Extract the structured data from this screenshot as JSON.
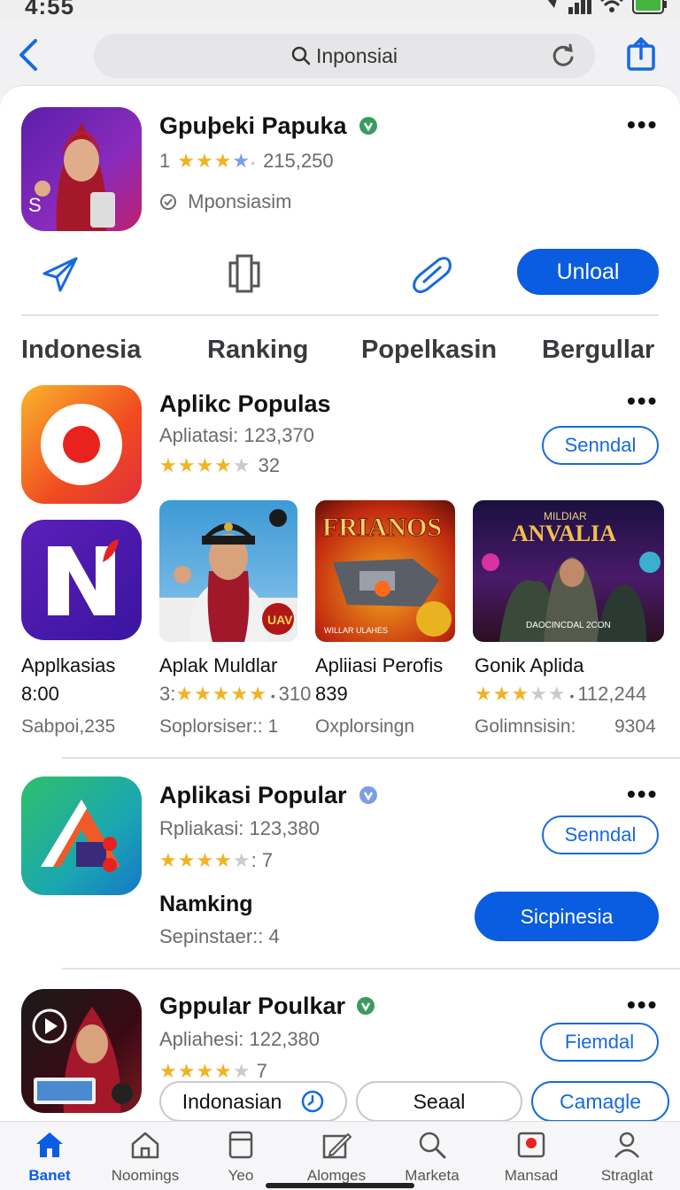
{
  "status": {
    "time": "4:55"
  },
  "topbar": {
    "search_text": "Inponsiai"
  },
  "hero": {
    "title": "Gpuþeki Papuka",
    "rating_prefix": "1",
    "rating_count": "215,250",
    "developer": "Mponsiasim",
    "download_label": "Unloal"
  },
  "tabs": [
    "Indonesia",
    "Ranking",
    "Popelkasin",
    "Bergullar"
  ],
  "section1": {
    "title": "Aplikc Populas",
    "subtitle": "Apliatasi: 123,370",
    "rating_count": "32",
    "button": "Senndal"
  },
  "cards": [
    {
      "name": "Applkasias",
      "value": "8:00",
      "sub": "Sabpoi",
      "sub2": "235"
    },
    {
      "name": "Aplak Muldlar",
      "value": "3:",
      "rating_count": "310",
      "sub": "Soplorsiser:: 1",
      "badge": "UAV"
    },
    {
      "name": "Apliiasi Perofis",
      "value": "839",
      "sub": "Oxplorsingn",
      "poster_text": "FRIANOS",
      "poster_caption": "WILLAR ULAHES"
    },
    {
      "name": "Gonik Aplida",
      "rating_count": "112,244",
      "sub": "Golimnsisin:",
      "sub2": "9304",
      "poster_top": "MILDIAR",
      "poster_text": "ANVALIA",
      "poster_caption": "DAOCINCDAL 2CON"
    }
  ],
  "section2": {
    "title": "Aplikasi Popular",
    "subtitle": "Rpliakasi: 123,380",
    "rating_count": ": 7",
    "button": "Senndal",
    "ranking_title": "Namking",
    "ranking_sub": "Sepinstaer:: 4",
    "ranking_button": "Sicpinesia"
  },
  "section3": {
    "title": "Gppular Poulkar",
    "subtitle": "Apliahesi: 122,380",
    "rating_count": "7",
    "button": "Fiemdal"
  },
  "chips": [
    "Indonasian",
    "Seaal",
    "Camagle"
  ],
  "tabbar": [
    {
      "label": "Banet",
      "icon": "home-icon",
      "active": true
    },
    {
      "label": "Noomings",
      "icon": "house-outline-icon",
      "active": false
    },
    {
      "label": "Yeo",
      "icon": "card-icon",
      "active": false
    },
    {
      "label": "Alomges",
      "icon": "pencil-icon",
      "active": false
    },
    {
      "label": "Marketa",
      "icon": "search-icon",
      "active": false
    },
    {
      "label": "Mansad",
      "icon": "gallery-icon",
      "active": false
    },
    {
      "label": "Straglat",
      "icon": "person-icon",
      "active": false
    }
  ],
  "colors": {
    "accent": "#0a5ce0",
    "star": "#f0b323",
    "verified": "#3a9c5c"
  }
}
